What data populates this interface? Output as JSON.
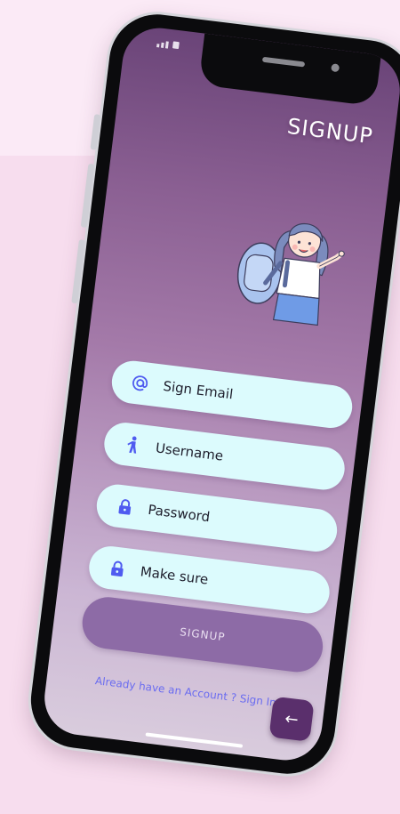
{
  "screen": {
    "title": "SIGNUP"
  },
  "form": {
    "fields": [
      {
        "label": "Sign Email",
        "icon": "at-icon"
      },
      {
        "label": "Username",
        "icon": "person-walking-icon"
      },
      {
        "label": "Password",
        "icon": "lock-icon"
      },
      {
        "label": "Make sure",
        "icon": "lock-icon"
      }
    ],
    "submit_label": "SIGNUP",
    "signin_prompt": "Already have an Account ? Sign In"
  },
  "fab": {
    "icon": "back-arrow-icon",
    "glyph": "←"
  },
  "colors": {
    "field_bg": "#dcfbfd",
    "accent_icon": "#4f5bf0",
    "button_bg": "#8d6ba6",
    "link": "#6a6cf0",
    "fab_bg": "#5a2f6c"
  }
}
